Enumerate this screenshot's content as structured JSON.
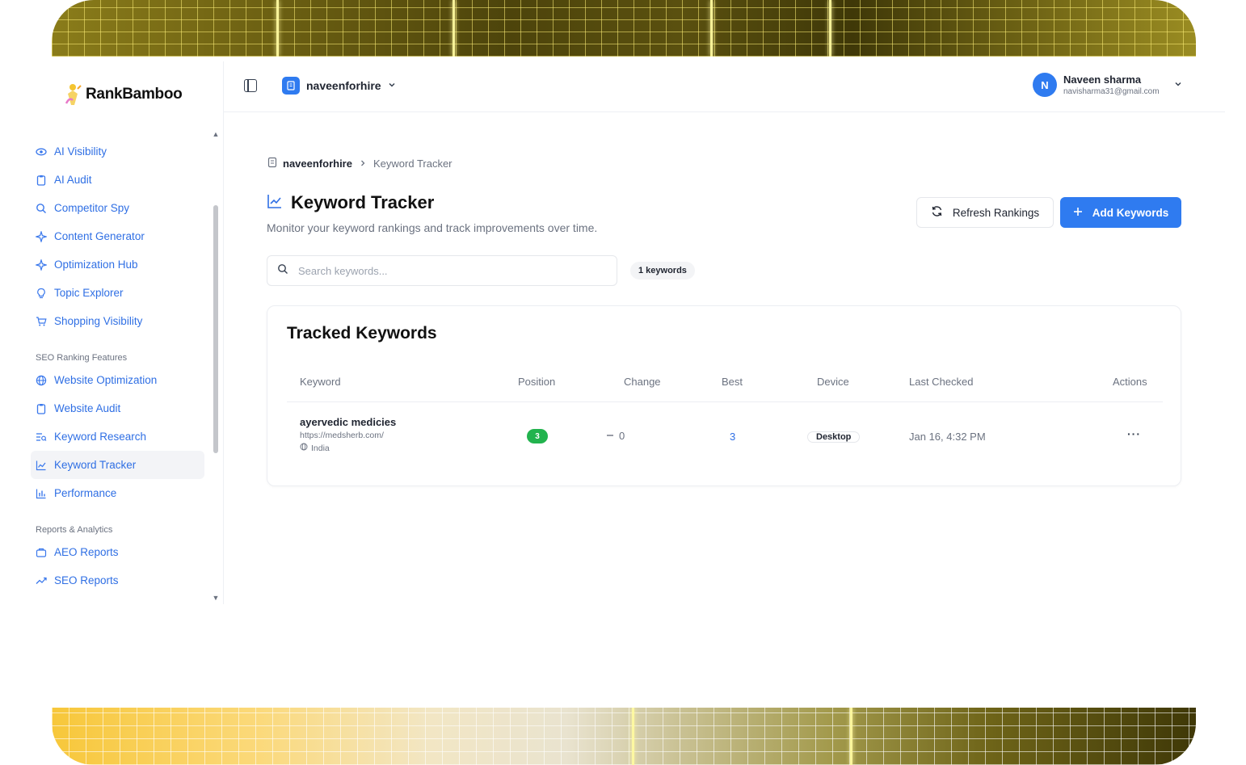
{
  "app": {
    "brand": "RankBamboo"
  },
  "sidebar": {
    "sections": [
      {
        "label": "",
        "items": [
          {
            "label": "AI Visibility",
            "icon": "eye-icon"
          },
          {
            "label": "AI Audit",
            "icon": "clipboard-icon"
          },
          {
            "label": "Competitor Spy",
            "icon": "search-icon"
          },
          {
            "label": "Content Generator",
            "icon": "sparkle-icon"
          },
          {
            "label": "Optimization Hub",
            "icon": "sparkle-icon"
          },
          {
            "label": "Topic Explorer",
            "icon": "lightbulb-icon"
          },
          {
            "label": "Shopping Visibility",
            "icon": "cart-icon"
          }
        ]
      },
      {
        "label": "SEO Ranking Features",
        "items": [
          {
            "label": "Website Optimization",
            "icon": "globe-icon"
          },
          {
            "label": "Website Audit",
            "icon": "clipboard-icon"
          },
          {
            "label": "Keyword Research",
            "icon": "list-search-icon"
          },
          {
            "label": "Keyword Tracker",
            "icon": "line-chart-icon",
            "active": true
          },
          {
            "label": "Performance",
            "icon": "bar-chart-icon"
          }
        ]
      },
      {
        "label": "Reports & Analytics",
        "items": [
          {
            "label": "AEO Reports",
            "icon": "box-icon"
          },
          {
            "label": "SEO Reports",
            "icon": "trend-up-icon"
          }
        ]
      }
    ]
  },
  "topbar": {
    "project_name": "naveenforhire",
    "user": {
      "initial": "N",
      "name": "Naveen sharma",
      "email": "navisharma31@gmail.com"
    }
  },
  "breadcrumb": {
    "home": "naveenforhire",
    "current": "Keyword Tracker"
  },
  "page": {
    "title": "Keyword Tracker",
    "subtitle": "Monitor your keyword rankings and track improvements over time.",
    "refresh_label": "Refresh Rankings",
    "add_label": "Add Keywords",
    "search_placeholder": "Search keywords...",
    "keyword_count": "1 keywords"
  },
  "table": {
    "title": "Tracked Keywords",
    "columns": [
      "Keyword",
      "Position",
      "Change",
      "Best",
      "Device",
      "Last Checked",
      "Actions"
    ],
    "rows": [
      {
        "keyword": "ayervedic medicies",
        "url": "https://medsherb.com/",
        "location": "India",
        "position": "3",
        "change": "0",
        "best": "3",
        "device": "Desktop",
        "last_checked": "Jan 16, 4:32 PM",
        "actions": "···"
      }
    ]
  },
  "colors": {
    "accent": "#2f7bf0",
    "link": "#2f6fe4",
    "success": "#22b34e"
  }
}
